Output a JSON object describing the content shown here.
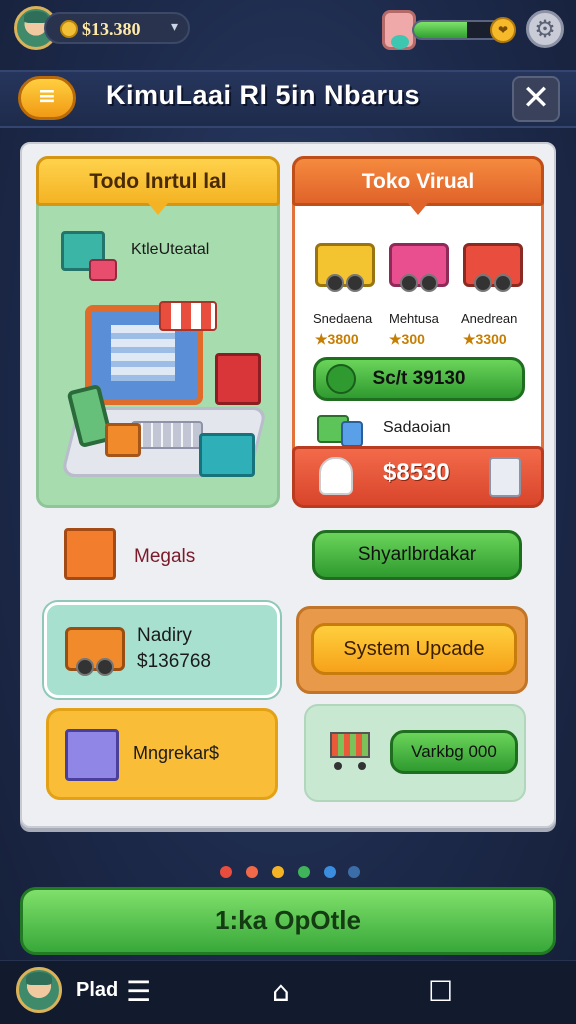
{
  "topbar": {
    "coins": "$13.380",
    "chevron_icon": "chevron-down-icon",
    "energy_level": 0.62,
    "energy_icon": "heart-icon",
    "settings_icon": "gear-icon"
  },
  "header": {
    "back_icon": "back-arrow-icon",
    "title": "KimuLaai Rl 5in Nbarus",
    "close_icon": "close-icon"
  },
  "left_card": {
    "title": "Todo lnrtul lal",
    "item_label": "KtleUteatal"
  },
  "right_card": {
    "title": "Toko Virual",
    "products": [
      {
        "name": "Snedaena",
        "price": "★3800",
        "color": "#f4c430"
      },
      {
        "name": "Mehtusa",
        "price": "★300",
        "color": "#e94e8f"
      },
      {
        "name": "Anedrean",
        "price": "★3300",
        "color": "#e84d3d"
      }
    ],
    "buy_button": "Sc/t 39130",
    "sub_label": "Sadaoian",
    "price": "$8530"
  },
  "rows": {
    "megals_label": "Megals",
    "right_button_1": "Shyarlbrdakar",
    "delivery_title": "Nadiry",
    "delivery_value": "$136768",
    "system_update": "System Upcade",
    "storage_label": "Mngrekar$",
    "cart_button": "Varkbg 000"
  },
  "pager": {
    "dots": [
      "#e84d3d",
      "#f06a4a",
      "#f4b324",
      "#3fb45a",
      "#3b8de0",
      "#3b6ea8"
    ]
  },
  "bottom_button": "1:ka OpOtle",
  "navbar": {
    "label": "Plad",
    "menu_icon": "menu-icon",
    "home_icon": "home-icon",
    "square_icon": "square-icon"
  }
}
